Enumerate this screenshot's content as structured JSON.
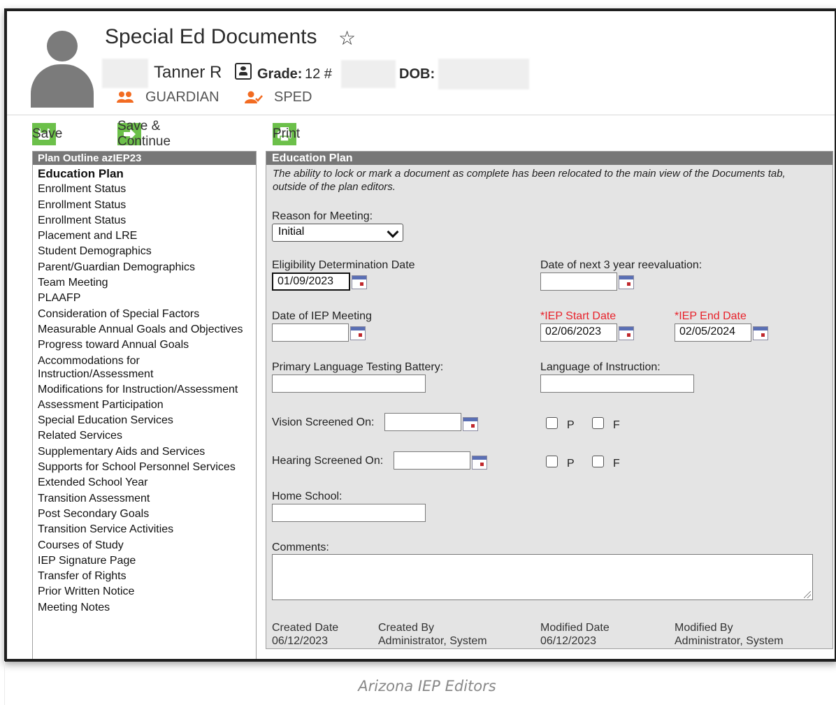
{
  "header": {
    "title": "Special Ed Documents",
    "student_name": "Tanner R",
    "grade_label": "Grade:",
    "grade_value": "12 #",
    "dob_label": "DOB:",
    "flags": [
      {
        "label": "GUARDIAN",
        "icon": "guardian-icon"
      },
      {
        "label": "SPED",
        "icon": "sped-icon"
      }
    ]
  },
  "toolbar": {
    "save": "Save",
    "save_continue": "Save & Continue",
    "print": "Print"
  },
  "outline": {
    "title": "Plan Outline azIEP23",
    "items": [
      "Education Plan",
      "Enrollment Status",
      "Enrollment Status",
      "Enrollment Status",
      "Placement and LRE",
      "Student Demographics",
      "Parent/Guardian Demographics",
      "Team Meeting",
      "PLAAFP",
      "Consideration of Special Factors",
      "Measurable Annual Goals and Objectives",
      "Progress toward Annual Goals",
      "Accommodations for Instruction/Assessment",
      "Modifications for Instruction/Assessment",
      "Assessment Participation",
      "Special Education Services",
      "Related Services",
      "Supplementary Aids and Services",
      "Supports for School Personnel Services",
      "Extended School Year",
      "Transition Assessment",
      "Post Secondary Goals",
      "Transition Service Activities",
      "Courses of Study",
      "IEP Signature Page",
      "Transfer of Rights",
      "Prior Written Notice",
      "Meeting Notes"
    ]
  },
  "editor": {
    "title": "Education Plan",
    "notice": "The ability to lock or mark a document as complete has been relocated to the main view of the Documents tab, outside of the plan editors.",
    "reason_label": "Reason for Meeting:",
    "reason_value": "Initial",
    "eligibility_label": "Eligibility Determination Date",
    "eligibility_value": "01/09/2023",
    "reeval_label": "Date of next 3 year reevaluation:",
    "reeval_value": "",
    "iep_meeting_label": "Date of IEP Meeting",
    "iep_meeting_value": "",
    "iep_start_label": "*IEP Start Date",
    "iep_start_value": "02/06/2023",
    "iep_end_label": "*IEP End Date",
    "iep_end_value": "02/05/2024",
    "primary_lang_label": "Primary Language Testing Battery:",
    "lang_instr_label": "Language of Instruction:",
    "vision_label": "Vision Screened On:",
    "hearing_label": "Hearing Screened On:",
    "pass_label": "P",
    "fail_label": "F",
    "home_school_label": "Home School:",
    "comments_label": "Comments:",
    "created_date_label": "Created Date",
    "created_date_value": "06/12/2023",
    "created_by_label": "Created By",
    "created_by_value": "Administrator, System",
    "modified_date_label": "Modified Date",
    "modified_date_value": "06/12/2023",
    "modified_by_label": "Modified By",
    "modified_by_value": "Administrator, System"
  },
  "caption": "Arizona IEP Editors",
  "colors": {
    "accent_green": "#6cc04a",
    "flag_orange": "#f26b21",
    "required_red": "#e8222b",
    "panel_header": "#777777"
  }
}
